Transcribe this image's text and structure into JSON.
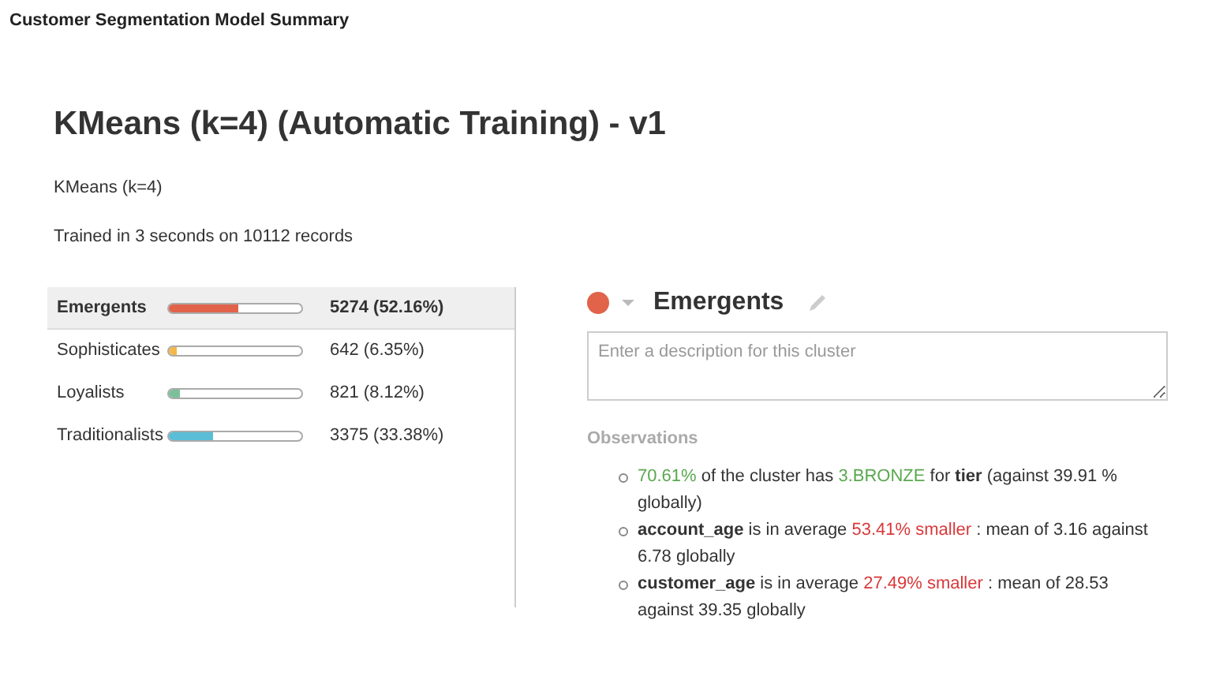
{
  "page_title": "Customer Segmentation Model Summary",
  "model": {
    "title": "KMeans (k=4) (Automatic Training) - v1",
    "algorithm": "KMeans (k=4)",
    "training_info": "Trained in 3 seconds on 10112 records"
  },
  "clusters": [
    {
      "name": "Emergents",
      "level": 0.5216,
      "reading": "5274 (52.16%)",
      "color": "#e0634a",
      "selected": true
    },
    {
      "name": "Sophisticates",
      "level": 0.0635,
      "reading": "642 (6.35%)",
      "color": "#f2b84b",
      "selected": false
    },
    {
      "name": "Loyalists",
      "level": 0.0812,
      "reading": "821 (8.12%)",
      "color": "#7cc09a",
      "selected": false
    },
    {
      "name": "Traditionalists",
      "level": 0.3338,
      "reading": "3375 (33.38%)",
      "color": "#5bbdd6",
      "selected": false
    }
  ],
  "detail": {
    "name": "Emergents",
    "color": "#e0634a",
    "description": {
      "placeholder": "Enter a description for this cluster"
    },
    "observations_label": "Observations",
    "observations": [
      [
        {
          "kind": "good",
          "text": "70.61%"
        },
        {
          "kind": "plain",
          "text": " of the cluster has "
        },
        {
          "kind": "good",
          "text": "3.BRONZE"
        },
        {
          "kind": "plain",
          "text": " for "
        },
        {
          "kind": "bold",
          "text": "tier"
        },
        {
          "kind": "plain",
          "text": " (against 39.91 % globally)"
        }
      ],
      [
        {
          "kind": "bold",
          "text": "account_age"
        },
        {
          "kind": "plain",
          "text": " is in average "
        },
        {
          "kind": "bad",
          "text": "53.41% smaller"
        },
        {
          "kind": "plain",
          "text": " : mean of 3.16 against 6.78 globally"
        }
      ],
      [
        {
          "kind": "bold",
          "text": "customer_age"
        },
        {
          "kind": "plain",
          "text": " is in average "
        },
        {
          "kind": "bad",
          "text": "27.49% smaller"
        },
        {
          "kind": "plain",
          "text": " : mean of 28.53 against 39.35 globally"
        }
      ]
    ]
  }
}
